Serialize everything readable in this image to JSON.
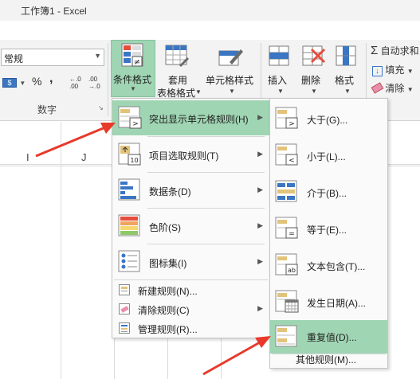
{
  "window": {
    "title": "工作簿1 - Excel"
  },
  "ribbon": {
    "number_format": {
      "value": "常规"
    },
    "number_buttons": {
      "percent": "%",
      "comma": ",",
      "inc_decimal": "←.0 .00",
      "dec_decimal": ".00 →.0",
      "currency": "$"
    },
    "number_group_label": "数字",
    "conditional_format": {
      "label": "条件格式"
    },
    "table_format": {
      "line1": "套用",
      "line2": "表格格式"
    },
    "cell_style": {
      "label": "单元格样式"
    },
    "insert": {
      "label": "插入"
    },
    "delete": {
      "label": "删除"
    },
    "format": {
      "label": "格式"
    },
    "autosum": {
      "label": "自动求和"
    },
    "fill": {
      "label": "填充"
    },
    "clear": {
      "label": "清除"
    }
  },
  "sheet": {
    "col_markers": [
      "I",
      "J"
    ]
  },
  "cf_menu": {
    "items": [
      {
        "label": "突出显示单元格规则(H)",
        "submenu": true,
        "highlighted": true
      },
      {
        "label": "项目选取规则(T)",
        "submenu": true
      },
      {
        "label": "数据条(D)",
        "submenu": true
      },
      {
        "label": "色阶(S)",
        "submenu": true
      },
      {
        "label": "图标集(I)",
        "submenu": true
      }
    ],
    "actions": [
      {
        "label": "新建规则(N)..."
      },
      {
        "label": "清除规则(C)",
        "submenu": true
      },
      {
        "label": "管理规则(R)..."
      }
    ]
  },
  "highlight_submenu": {
    "items": [
      {
        "label": "大于(G)..."
      },
      {
        "label": "小于(L)..."
      },
      {
        "label": "介于(B)..."
      },
      {
        "label": "等于(E)..."
      },
      {
        "label": "文本包含(T)..."
      },
      {
        "label": "发生日期(A)..."
      },
      {
        "label": "重复值(D)...",
        "highlighted": true
      }
    ],
    "more": "其他规则(M)..."
  },
  "colors": {
    "highlight": "#9fd5b3",
    "ribbon_bg": "#f3f3f3",
    "annotation_arrow": "#e8392b"
  }
}
